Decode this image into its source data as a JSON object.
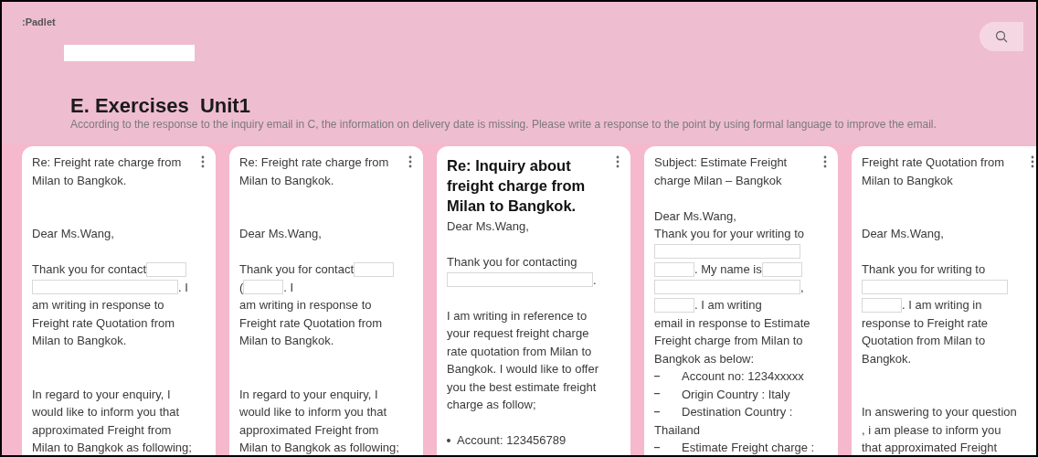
{
  "header": {
    "logo": ":Padlet",
    "title": "E. Exercises  Unit1",
    "description": "According to the response to the inquiry email in C, the information on delivery date is missing. Please write a response to the point by using formal language to improve the email."
  },
  "cards": [
    {
      "lines": [
        {
          "kind": "text",
          "parts": [
            "Re: Freight rate charge from"
          ]
        },
        {
          "kind": "text",
          "parts": [
            "Milan to Bangkok."
          ]
        },
        {
          "kind": "empty"
        },
        {
          "kind": "empty"
        },
        {
          "kind": "text",
          "parts": [
            "Dear Ms.Wang,"
          ]
        },
        {
          "kind": "empty"
        },
        {
          "kind": "text",
          "parts": [
            "Thank you for contact",
            {
              "kind": "blank"
            }
          ]
        },
        {
          "kind": "text",
          "parts": [
            {
              "kind": "blank"
            },
            ". I"
          ]
        },
        {
          "kind": "text",
          "parts": [
            "am writing in response to"
          ]
        },
        {
          "kind": "text",
          "parts": [
            "Freight rate Quotation from"
          ]
        },
        {
          "kind": "text",
          "parts": [
            "Milan to Bangkok."
          ]
        },
        {
          "kind": "empty"
        },
        {
          "kind": "empty"
        },
        {
          "kind": "text",
          "parts": [
            "In regard to your enquiry, I"
          ]
        },
        {
          "kind": "text",
          "parts": [
            "would like to inform you that"
          ]
        },
        {
          "kind": "text",
          "parts": [
            "approximated Freight from"
          ]
        },
        {
          "kind": "text",
          "parts": [
            "Milan to Bangkok as following;"
          ]
        }
      ]
    },
    {
      "lines": [
        {
          "kind": "text",
          "parts": [
            "Re: Freight rate charge from"
          ]
        },
        {
          "kind": "text",
          "parts": [
            "Milan to Bangkok."
          ]
        },
        {
          "kind": "empty"
        },
        {
          "kind": "empty"
        },
        {
          "kind": "text",
          "parts": [
            "Dear Ms.Wang,"
          ]
        },
        {
          "kind": "empty"
        },
        {
          "kind": "text",
          "parts": [
            "Thank you for contact",
            {
              "kind": "blank"
            }
          ]
        },
        {
          "kind": "text",
          "parts": [
            "(",
            {
              "kind": "blank"
            },
            ". I"
          ]
        },
        {
          "kind": "text",
          "parts": [
            "am writing in response to"
          ]
        },
        {
          "kind": "text",
          "parts": [
            "Freight rate Quotation from"
          ]
        },
        {
          "kind": "text",
          "parts": [
            "Milan to Bangkok."
          ]
        },
        {
          "kind": "empty"
        },
        {
          "kind": "empty"
        },
        {
          "kind": "text",
          "parts": [
            "In regard to your enquiry, I"
          ]
        },
        {
          "kind": "text",
          "parts": [
            "would like to inform you that"
          ]
        },
        {
          "kind": "text",
          "parts": [
            "approximated Freight from"
          ]
        },
        {
          "kind": "text",
          "parts": [
            "Milan to Bangkok as following;"
          ]
        }
      ]
    },
    {
      "title": "Re: Inquiry about freight charge from Milan to Bangkok.",
      "lines": [
        {
          "kind": "text",
          "parts": [
            "Dear Ms.Wang,"
          ]
        },
        {
          "kind": "empty"
        },
        {
          "kind": "text",
          "parts": [
            "Thank you for contacting"
          ]
        },
        {
          "kind": "text",
          "parts": [
            {
              "kind": "blank"
            },
            "."
          ]
        },
        {
          "kind": "empty"
        },
        {
          "kind": "text",
          "parts": [
            "I am writing in reference to"
          ]
        },
        {
          "kind": "text",
          "parts": [
            "your request freight charge"
          ]
        },
        {
          "kind": "text",
          "parts": [
            "rate quotation from Milan to"
          ]
        },
        {
          "kind": "text",
          "parts": [
            "Bangkok. I would like to offer"
          ]
        },
        {
          "kind": "text",
          "parts": [
            "you the best estimate freight"
          ]
        },
        {
          "kind": "text",
          "parts": [
            "charge as follow;"
          ]
        },
        {
          "kind": "empty"
        },
        {
          "kind": "bullet",
          "text": "Account: 123456789"
        }
      ]
    },
    {
      "lines": [
        {
          "kind": "text",
          "parts": [
            "Subject: Estimate Freight"
          ]
        },
        {
          "kind": "text",
          "parts": [
            "charge Milan – Bangkok"
          ]
        },
        {
          "kind": "empty"
        },
        {
          "kind": "text",
          "parts": [
            "Dear Ms.Wang,"
          ]
        },
        {
          "kind": "text",
          "parts": [
            "Thank you for your writing to"
          ]
        },
        {
          "kind": "text",
          "parts": [
            {
              "kind": "blank"
            }
          ]
        },
        {
          "kind": "text",
          "parts": [
            {
              "kind": "blank"
            },
            ". My name is",
            {
              "kind": "blank"
            }
          ]
        },
        {
          "kind": "text",
          "parts": [
            {
              "kind": "blank"
            },
            ","
          ]
        },
        {
          "kind": "text",
          "parts": [
            {
              "kind": "blank"
            },
            ". I am writing"
          ]
        },
        {
          "kind": "text",
          "parts": [
            "email in response to Estimate"
          ]
        },
        {
          "kind": "text",
          "parts": [
            "Freight charge from Milan to"
          ]
        },
        {
          "kind": "text",
          "parts": [
            "Bangkok as below:"
          ]
        },
        {
          "kind": "dash",
          "text": "Account no: 1234xxxxx"
        },
        {
          "kind": "dash",
          "text": "Origin Country : Italy"
        },
        {
          "kind": "dash",
          "text": "Destination Country :"
        },
        {
          "kind": "text",
          "parts": [
            "Thailand"
          ]
        },
        {
          "kind": "dash",
          "text": "Estimate Freight charge :"
        }
      ]
    },
    {
      "lines": [
        {
          "kind": "text",
          "parts": [
            "Freight rate Quotation from"
          ]
        },
        {
          "kind": "text",
          "parts": [
            "Milan to Bangkok"
          ]
        },
        {
          "kind": "empty"
        },
        {
          "kind": "empty"
        },
        {
          "kind": "text",
          "parts": [
            "Dear Ms.Wang,"
          ]
        },
        {
          "kind": "empty"
        },
        {
          "kind": "text",
          "parts": [
            "Thank you for writing to"
          ]
        },
        {
          "kind": "text",
          "parts": [
            {
              "kind": "blank"
            }
          ]
        },
        {
          "kind": "text",
          "parts": [
            {
              "kind": "blank"
            },
            ". I am writing in"
          ]
        },
        {
          "kind": "text",
          "parts": [
            "response to Freight rate"
          ]
        },
        {
          "kind": "text",
          "parts": [
            "Quotation from Milan to"
          ]
        },
        {
          "kind": "text",
          "parts": [
            "Bangkok."
          ]
        },
        {
          "kind": "empty"
        },
        {
          "kind": "empty"
        },
        {
          "kind": "text",
          "parts": [
            "In answering to your question"
          ]
        },
        {
          "kind": "text",
          "parts": [
            ", i am please to inform you"
          ]
        },
        {
          "kind": "text",
          "parts": [
            "that approximated Freight"
          ]
        }
      ]
    }
  ]
}
